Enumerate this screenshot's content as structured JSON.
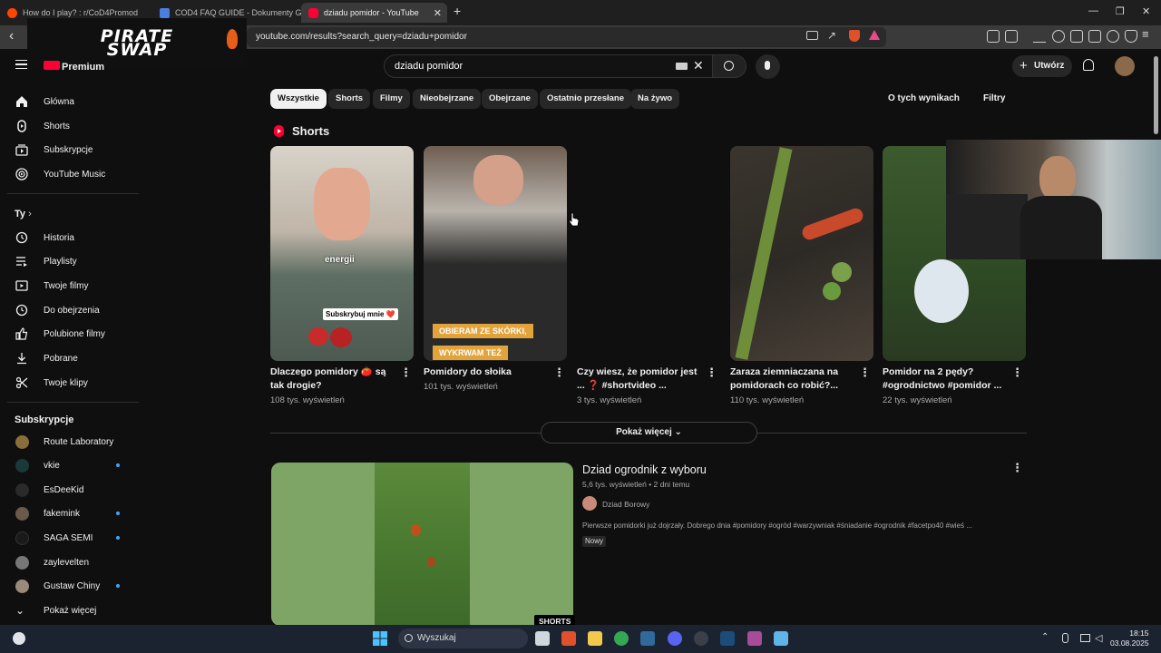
{
  "browser": {
    "tabs": [
      {
        "title": "How do I play? : r/CoD4Promod"
      },
      {
        "title": "COD4 FAQ GUIDE - Dokumenty Goo"
      },
      {
        "title": "dziadu pomidor - YouTube"
      }
    ],
    "url": "youtube.com/results?search_query=dziadu+pomidor"
  },
  "overlay_logo": {
    "line1": "PIRATE",
    "line2": "SWAP"
  },
  "header": {
    "brand_partial": "Premium",
    "search_value": "dziadu pomidor",
    "create_label": "Utwórz"
  },
  "sidebar": {
    "main": [
      {
        "label": "Główna",
        "icon": "home-icon"
      },
      {
        "label": "Shorts",
        "icon": "shorts-icon"
      },
      {
        "label": "Subskrypcje",
        "icon": "subscriptions-icon"
      },
      {
        "label": "YouTube Music",
        "icon": "music-icon"
      }
    ],
    "you_heading": "Ty",
    "you": [
      {
        "label": "Historia",
        "icon": "history-icon"
      },
      {
        "label": "Playlisty",
        "icon": "playlists-icon"
      },
      {
        "label": "Twoje filmy",
        "icon": "your-videos-icon"
      },
      {
        "label": "Do obejrzenia",
        "icon": "watch-later-icon"
      },
      {
        "label": "Polubione filmy",
        "icon": "liked-icon"
      },
      {
        "label": "Pobrane",
        "icon": "download-icon"
      },
      {
        "label": "Twoje klipy",
        "icon": "clips-icon"
      }
    ],
    "subs_heading": "Subskrypcje",
    "subs": [
      {
        "label": "Route Laboratory",
        "dot": false,
        "color": "#8a6d3b"
      },
      {
        "label": "vkie",
        "dot": true,
        "color": "#1a3a3a"
      },
      {
        "label": "EsDeeKid",
        "dot": false,
        "color": "#2a2a2a"
      },
      {
        "label": "fakemink",
        "dot": true,
        "color": "#6a5a4a"
      },
      {
        "label": "SAGA SEMI",
        "dot": true,
        "color": "#1a1a1a"
      },
      {
        "label": "zaylevelten",
        "dot": false,
        "color": "#777777"
      },
      {
        "label": "Gustaw Chiny",
        "dot": true,
        "color": "#9a8a7a"
      }
    ],
    "show_more": "Pokaż więcej"
  },
  "chips": [
    "Wszystkie",
    "Shorts",
    "Filmy",
    "Nieobejrzane",
    "Obejrzane",
    "Ostatnio przesłane",
    "Na żywo"
  ],
  "about_results": "O tych wynikach",
  "filters": "Filtry",
  "shorts_section": {
    "title": "Shorts",
    "items": [
      {
        "title": "Dlaczego pomidory 🍅 są tak drogie?",
        "views": "108 tys. wyświetleń",
        "overlay1": "energii",
        "overlay2": "Subskrybuj mnie ❤️"
      },
      {
        "title": "Pomidory do słoika",
        "views": "101 tys. wyświetleń",
        "overlay1": "OBIERAM ZE SKÓRKI,",
        "overlay2": "WYKRWAM TEŻ"
      },
      {
        "title": "Czy wiesz, że pomidor jest ... ❓ #shortvideo ...",
        "views": "3 tys. wyświetleń"
      },
      {
        "title": "Zaraza ziemniaczana na pomidorach co robić?...",
        "views": "110 tys. wyświetleń"
      },
      {
        "title": "Pomidor na 2 pędy? #ogrodnictwo #pomidor ...",
        "views": "22 tys. wyświetleń"
      }
    ],
    "show_more": "Pokaż więcej"
  },
  "video": {
    "title": "Dziad ogrodnik z wyboru",
    "meta": "5,6 tys. wyświetleń • 2 dni temu",
    "channel": "Dziad Borowy",
    "description": "Pierwsze pomidorki już dojrzały. Dobrego dnia #pomidory #ogród #warzywniak #śniadanie #ogrodnik #facetpo40 #wieś ...",
    "badge": "Nowy",
    "shorts_badge": "SHORTS"
  },
  "taskbar": {
    "search_placeholder": "Wyszukaj",
    "time": "18:15",
    "date": "03.08.2025"
  }
}
